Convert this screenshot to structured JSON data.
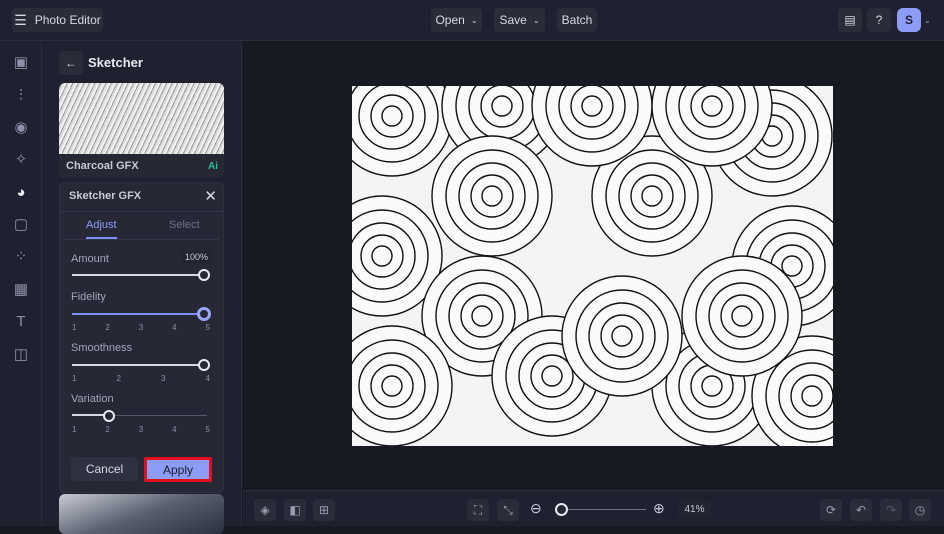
{
  "header": {
    "app_title": "Photo Editor",
    "open": "Open",
    "save": "Save",
    "batch": "Batch",
    "avatar": "S"
  },
  "panel": {
    "title": "Sketcher",
    "preset_top": {
      "name": "Charcoal GFX",
      "badge": "Ai"
    },
    "effect": {
      "name": "Sketcher GFX",
      "tabs": [
        "Adjust",
        "Select"
      ],
      "amount": {
        "label": "Amount",
        "value": "100%",
        "fraction": 1.0
      },
      "fidelity": {
        "label": "Fidelity",
        "ticks": [
          "1",
          "2",
          "3",
          "4",
          "5"
        ],
        "value": 5
      },
      "smoothness": {
        "label": "Smoothness",
        "ticks": [
          "1",
          "2",
          "3",
          "4"
        ],
        "value": 4
      },
      "variation": {
        "label": "Variation",
        "ticks": [
          "1",
          "2",
          "3",
          "4",
          "5"
        ],
        "value": 2
      },
      "cancel": "Cancel",
      "apply": "Apply"
    }
  },
  "footer": {
    "zoom": "41%",
    "zoom_fraction": 0.05
  },
  "colors": {
    "accent": "#7f8ff5",
    "apply_outline": "#e0101e",
    "ai_badge": "#2fbf9a"
  }
}
